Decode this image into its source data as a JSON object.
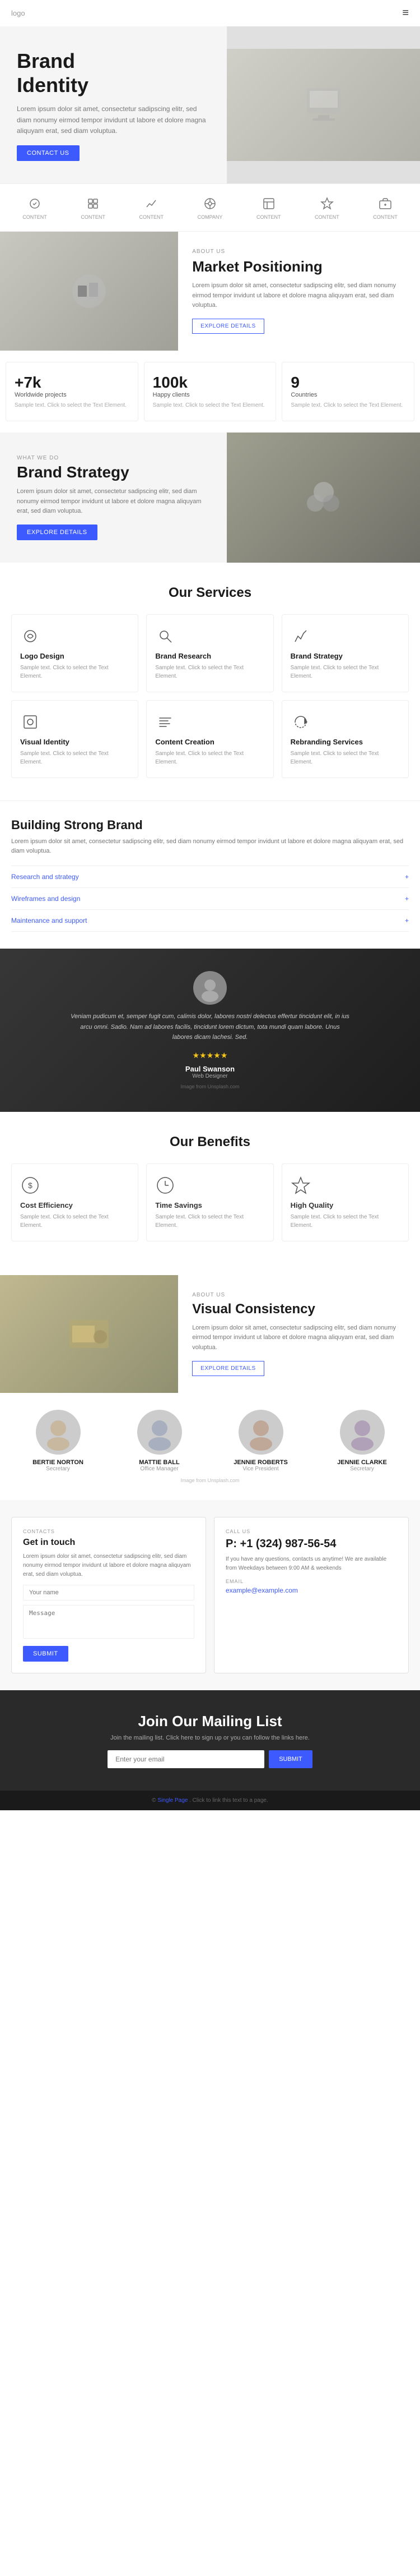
{
  "header": {
    "logo": "logo",
    "menu_icon": "≡"
  },
  "hero": {
    "title_line1": "Brand",
    "title_line2": "Identity",
    "description": "Lorem ipsum dolor sit amet, consectetur sadipscing elitr, sed diam nonumy eirmod tempor invidunt ut labore et dolore magna aliquyam erat, sed diam voluptua.",
    "cta_label": "CONTACT US"
  },
  "icons_row": {
    "items": [
      {
        "label": "CONTENT"
      },
      {
        "label": "CONTENT"
      },
      {
        "label": "CONTENT"
      },
      {
        "label": "COMPANY"
      },
      {
        "label": "CONTENT"
      },
      {
        "label": "CONTENT"
      },
      {
        "label": "CONTENT"
      }
    ]
  },
  "market": {
    "about_label": "ABOUT US",
    "title": "Market Positioning",
    "description": "Lorem ipsum dolor sit amet, consectetur sadipscing elitr, sed diam nonumy eirmod tempor invidunt ut labore et dolore magna aliquyam erat, sed diam voluptua.",
    "cta_label": "EXPLORE DETAILS"
  },
  "stats": [
    {
      "number": "+7k",
      "label": "Worldwide projects",
      "description": "Sample text. Click to select the Text Element."
    },
    {
      "number": "100k",
      "label": "Happy clients",
      "description": "Sample text. Click to select the Text Element."
    },
    {
      "number": "9",
      "label": "Countries",
      "description": "Sample text. Click to select the Text Element."
    }
  ],
  "brand_strategy": {
    "what_we_do": "WHAT WE DO",
    "title": "Brand Strategy",
    "description": "Lorem ipsum dolor sit amet, consectetur sadipscing elitr, sed diam nonumy eirmod tempor invidunt ut labore et dolore magna aliquyam erat, sed diam voluptua.",
    "cta_label": "EXPLORE DETAILS"
  },
  "services": {
    "title": "Our Services",
    "items": [
      {
        "title": "Logo Design",
        "description": "Sample text. Click to select the Text Element."
      },
      {
        "title": "Brand Research",
        "description": "Sample text. Click to select the Text Element."
      },
      {
        "title": "Brand Strategy",
        "description": "Sample text. Click to select the Text Element."
      },
      {
        "title": "Visual Identity",
        "description": "Sample text. Click to select the Text Element."
      },
      {
        "title": "Content Creation",
        "description": "Sample text. Click to select the Text Element."
      },
      {
        "title": "Rebranding Services",
        "description": "Sample text. Click to select the Text Element."
      }
    ]
  },
  "building": {
    "title": "Building Strong Brand",
    "description": "Lorem ipsum dolor sit amet, consectetur sadipscing elitr, sed diam nonumy eirmod tempor invidunt ut labore et dolore magna aliquyam erat, sed diam voluptua.",
    "accordion": [
      {
        "label": "Research and strategy"
      },
      {
        "label": "Wireframes and design"
      },
      {
        "label": "Maintenance and support"
      }
    ]
  },
  "testimonial": {
    "text": "Veniam pudicum et, semper fugit cum, calimis dolor, labores nostri delectus effertur tincidunt elit, in ius arcu omni. Sadio. Nam ad labores facilis, tincidunt lorem dictum, tota mundi quam labore. Unus labores dicam lachesi. Sed.",
    "name": "Paul Swanson",
    "role": "Web Designer",
    "image_from": "Image from Unsplash.com"
  },
  "benefits": {
    "title": "Our Benefits",
    "items": [
      {
        "title": "Cost Efficiency",
        "description": "Sample text. Click to select the Text Element."
      },
      {
        "title": "Time Savings",
        "description": "Sample text. Click to select the Text Element."
      },
      {
        "title": "High Quality",
        "description": "Sample text. Click to select the Text Element."
      }
    ]
  },
  "visual": {
    "about_label": "ABOUT US",
    "title": "Visual Consistency",
    "description": "Lorem ipsum dolor sit amet, consectetur sadipscing elitr, sed diam nonumy eirmod tempor invidunt ut labore et dolore magna aliquyam erat, sed diam voluptua.",
    "cta_label": "EXPLORE DETAILS"
  },
  "team": {
    "members": [
      {
        "name": "BERTIE NORTON",
        "role": "Secretary"
      },
      {
        "name": "MATTIE BALL",
        "role": "Office Manager"
      },
      {
        "name": "JENNIE ROBERTS",
        "role": "Vice President"
      },
      {
        "name": "JENNIE CLARKE",
        "role": "Secretary"
      }
    ],
    "image_from": "Image from Unsplash.com"
  },
  "contact": {
    "contacts_label": "CONTACTS",
    "title": "Get in touch",
    "description": "Lorem ipsum dolor sit amet, consectetur sadipscing elitr, sed diam nonumy eirmod tempor invidunt ut labore et dolore magna aliquyam erat, sed diam voluptua.",
    "name_placeholder": "Your name",
    "message_placeholder": "Message"
  },
  "call": {
    "call_label": "CALL US",
    "phone": "P: +1 (324) 987-56-54",
    "call_description": "If you have any questions, contacts us anytime! We are available from Weekdays between 9:00 AM & weekends",
    "email_label": "EMAIL",
    "email": "example@example.com"
  },
  "mailing": {
    "title": "Join Our Mailing List",
    "description": "Join the mailing list. Click here to sign up or you can follow the links here.",
    "email_placeholder": "Enter your email",
    "cta_label": "SUBMIT"
  },
  "footer": {
    "text": "© Single Page. Click to link this text to a page.",
    "link_label": "Single Page"
  }
}
